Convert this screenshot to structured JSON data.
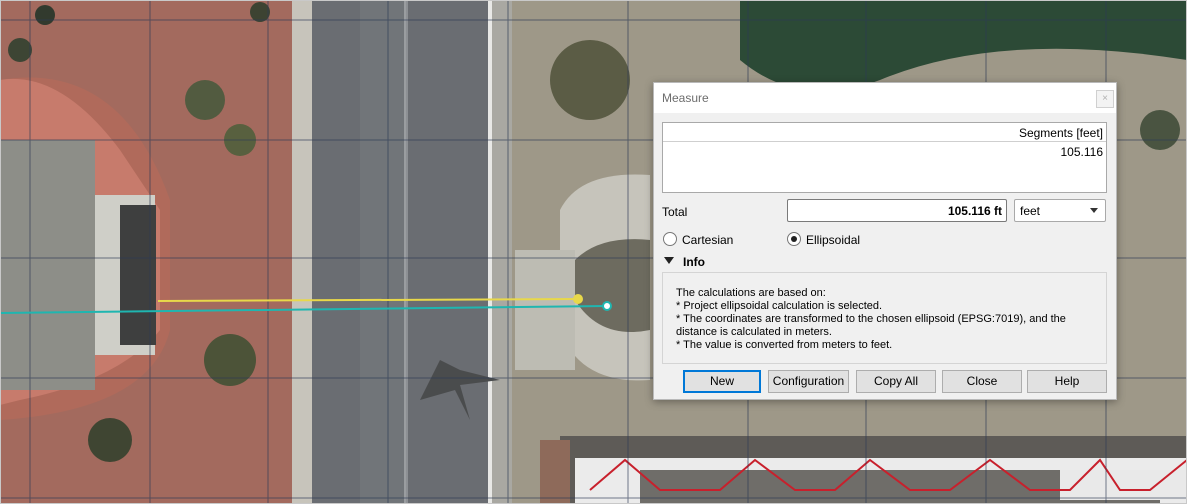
{
  "dialog": {
    "title": "Measure",
    "close_glyph": "×",
    "segments_header": "Segments [feet]",
    "segments": [
      "105.116"
    ],
    "total_label": "Total",
    "total_value": "105.116 ft",
    "unit": "feet",
    "radio_cartesian": "Cartesian",
    "radio_ellipsoidal": "Ellipsoidal",
    "selected_mode": "Ellipsoidal",
    "info_label": "Info",
    "info_lines": [
      "The calculations are based on:",
      "* Project ellipsoidal calculation is selected.",
      "* The coordinates are transformed to the chosen ellipsoid (EPSG:7019), and the",
      "distance is calculated in meters.",
      "* The value is converted from meters to feet."
    ],
    "buttons": {
      "new": "New",
      "configuration": "Configuration",
      "copy_all": "Copy All",
      "close": "Close",
      "help": "Help"
    }
  },
  "map": {
    "measure_line_color": "#e8d84a",
    "cursor_line_color": "#1fb6b0",
    "grid_color": "#2d3a55",
    "fence_color": "#c8202c"
  }
}
